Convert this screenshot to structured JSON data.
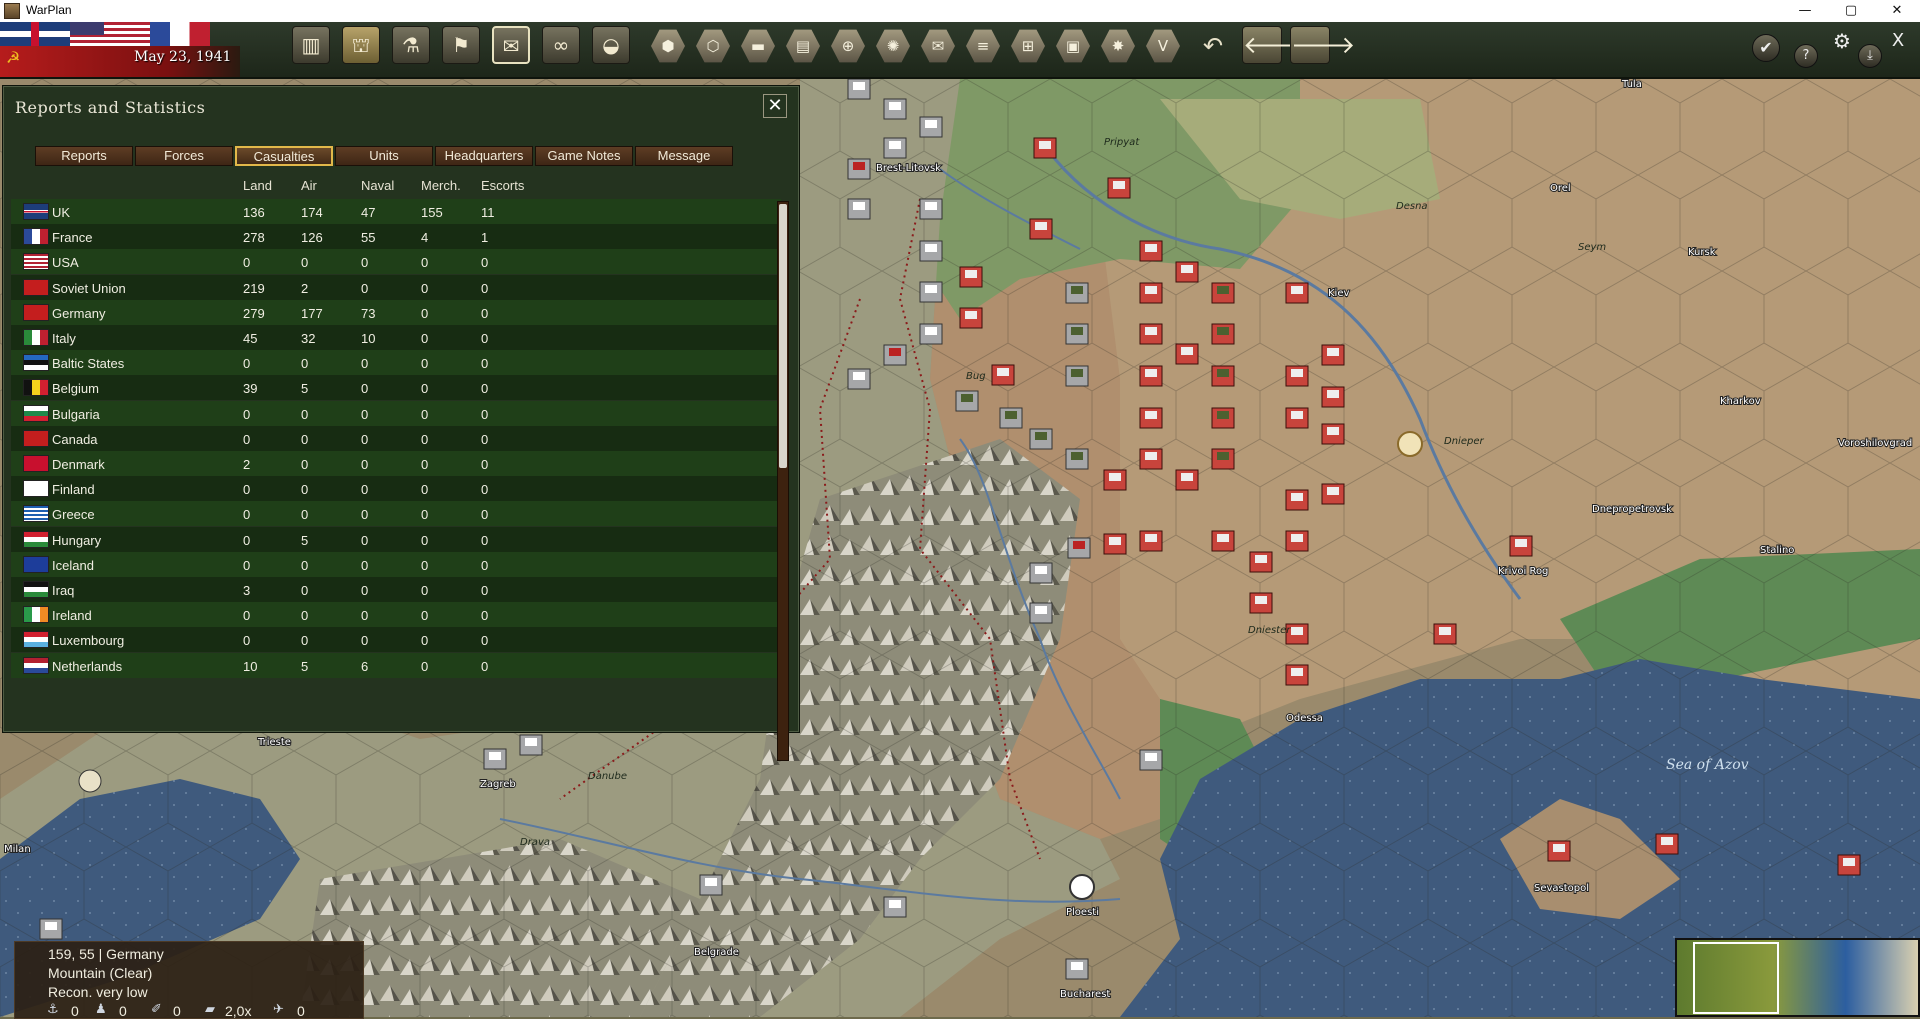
{
  "window": {
    "title": "WarPlan",
    "buttons": [
      "—",
      "▢",
      "✕"
    ]
  },
  "topbar": {
    "date": "May 23, 1941",
    "toolbar_icons": [
      "factory-icon",
      "supply-icon",
      "research-icon",
      "flag-icon",
      "reports-icon",
      "binoculars-icon",
      "helmet-icon"
    ],
    "hex_filters": [
      "terrain",
      "hex",
      "rail",
      "supply",
      "target",
      "city",
      "air",
      "route",
      "grid",
      "frame",
      "combat",
      "victory"
    ],
    "end_turn_icon": "checkmark-icon",
    "help": "?"
  },
  "panel": {
    "title": "Reports and Statistics",
    "tabs": [
      "Reports",
      "Forces",
      "Casualties",
      "Units",
      "Headquarters",
      "Game Notes",
      "Message"
    ],
    "active_tab": "Casualties",
    "columns": [
      "Land",
      "Air",
      "Naval",
      "Merch.",
      "Escorts"
    ],
    "rows": [
      {
        "country": "UK",
        "land": "136",
        "air": "174",
        "naval": "47",
        "merch": "155",
        "escorts": "11"
      },
      {
        "country": "France",
        "land": "278",
        "air": "126",
        "naval": "55",
        "merch": "4",
        "escorts": "1"
      },
      {
        "country": "USA",
        "land": "0",
        "air": "0",
        "naval": "0",
        "merch": "0",
        "escorts": "0"
      },
      {
        "country": "Soviet Union",
        "land": "219",
        "air": "2",
        "naval": "0",
        "merch": "0",
        "escorts": "0"
      },
      {
        "country": "Germany",
        "land": "279",
        "air": "177",
        "naval": "73",
        "merch": "0",
        "escorts": "0"
      },
      {
        "country": "Italy",
        "land": "45",
        "air": "32",
        "naval": "10",
        "merch": "0",
        "escorts": "0"
      },
      {
        "country": "Baltic States",
        "land": "0",
        "air": "0",
        "naval": "0",
        "merch": "0",
        "escorts": "0"
      },
      {
        "country": "Belgium",
        "land": "39",
        "air": "5",
        "naval": "0",
        "merch": "0",
        "escorts": "0"
      },
      {
        "country": "Bulgaria",
        "land": "0",
        "air": "0",
        "naval": "0",
        "merch": "0",
        "escorts": "0"
      },
      {
        "country": "Canada",
        "land": "0",
        "air": "0",
        "naval": "0",
        "merch": "0",
        "escorts": "0"
      },
      {
        "country": "Denmark",
        "land": "2",
        "air": "0",
        "naval": "0",
        "merch": "0",
        "escorts": "0"
      },
      {
        "country": "Finland",
        "land": "0",
        "air": "0",
        "naval": "0",
        "merch": "0",
        "escorts": "0"
      },
      {
        "country": "Greece",
        "land": "0",
        "air": "0",
        "naval": "0",
        "merch": "0",
        "escorts": "0"
      },
      {
        "country": "Hungary",
        "land": "0",
        "air": "5",
        "naval": "0",
        "merch": "0",
        "escorts": "0"
      },
      {
        "country": "Iceland",
        "land": "0",
        "air": "0",
        "naval": "0",
        "merch": "0",
        "escorts": "0"
      },
      {
        "country": "Iraq",
        "land": "3",
        "air": "0",
        "naval": "0",
        "merch": "0",
        "escorts": "0"
      },
      {
        "country": "Ireland",
        "land": "0",
        "air": "0",
        "naval": "0",
        "merch": "0",
        "escorts": "0"
      },
      {
        "country": "Luxembourg",
        "land": "0",
        "air": "0",
        "naval": "0",
        "merch": "0",
        "escorts": "0"
      },
      {
        "country": "Netherlands",
        "land": "10",
        "air": "5",
        "naval": "6",
        "merch": "0",
        "escorts": "0"
      }
    ]
  },
  "hex_info": {
    "coords": "159, 55",
    "owner": "Germany",
    "terrain": "Mountain (Clear)",
    "recon": "Recon. very low",
    "stats": [
      "0",
      "0",
      "0",
      "2,0x",
      "0"
    ]
  },
  "map": {
    "sea_labels": [
      "Sea of Azov"
    ],
    "cities": [
      "Kiev",
      "Kharkov",
      "Kursk",
      "Orel",
      "Tula",
      "Dnepropetrovsk",
      "Krivoi Rog",
      "Stalino",
      "Odessa",
      "Sevastopol",
      "Belgrade",
      "Bucharest",
      "Ploesti",
      "Zagreb",
      "Trieste",
      "Milan",
      "Brest-Litovsk",
      "Voroshilovgrad"
    ],
    "rivers": [
      "Pripyat",
      "Desna",
      "Seym",
      "Dnieper",
      "Bug",
      "Dniester",
      "Danube",
      "Drava"
    ]
  }
}
